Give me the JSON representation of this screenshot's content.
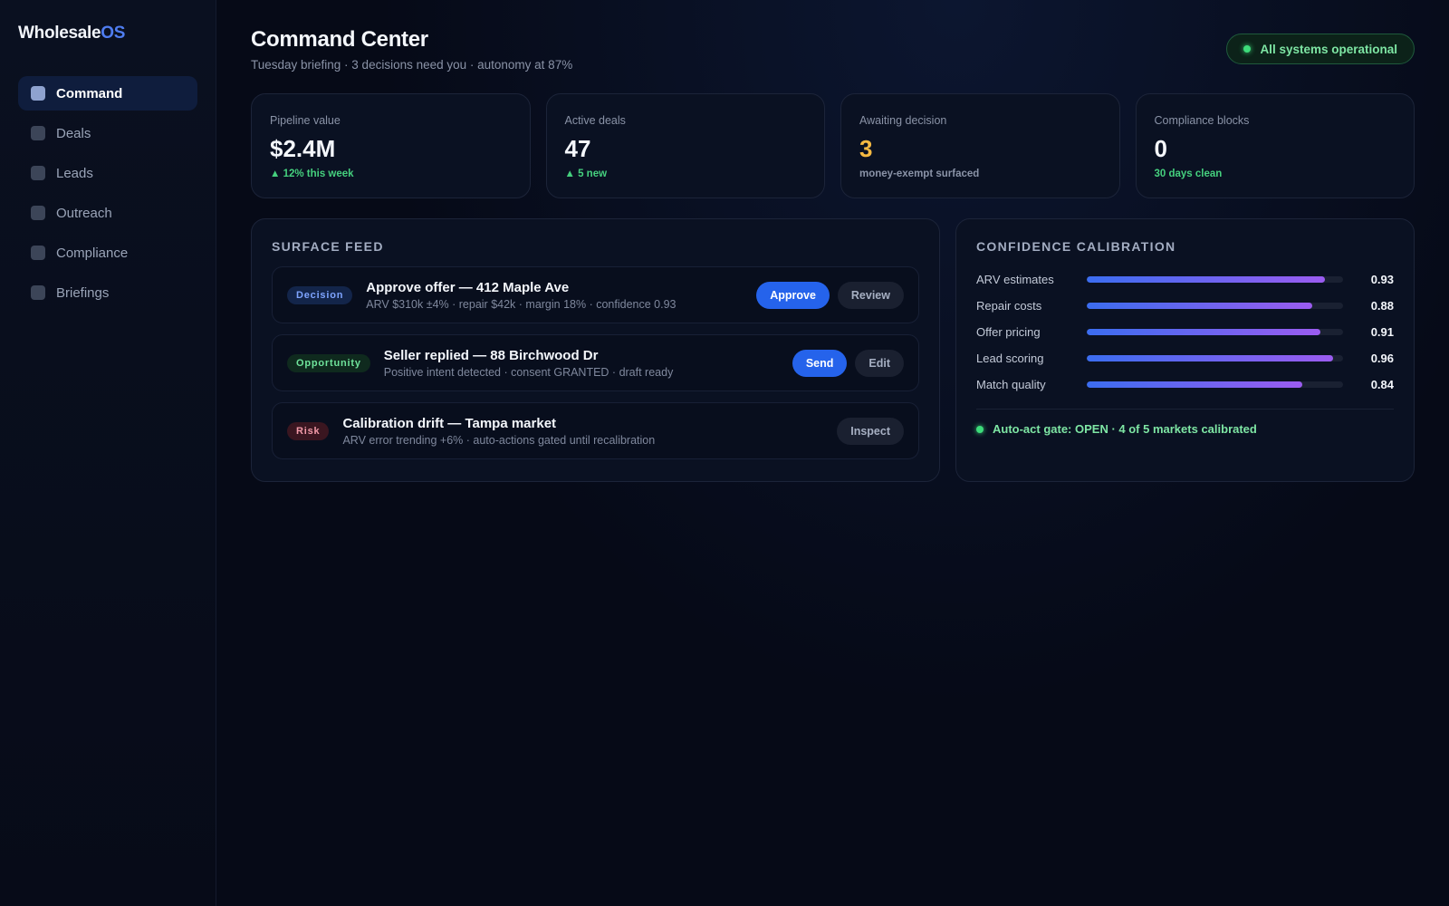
{
  "brand": {
    "name": "Wholesale",
    "accent": "OS"
  },
  "sidebar": {
    "items": [
      {
        "label": "Command",
        "icon": "command-icon",
        "active": true
      },
      {
        "label": "Deals",
        "icon": "deals-icon"
      },
      {
        "label": "Leads",
        "icon": "leads-icon"
      },
      {
        "label": "Outreach",
        "icon": "outreach-icon"
      },
      {
        "label": "Compliance",
        "icon": "compliance-icon"
      },
      {
        "label": "Briefings",
        "icon": "briefings-icon"
      }
    ]
  },
  "header": {
    "title": "Command Center",
    "subtitle": "Tuesday briefing · 3 decisions need you · autonomy at 87%",
    "status": "All systems operational"
  },
  "kpis": [
    {
      "label": "Pipeline value",
      "value": "$2.4M",
      "sub": "▲ 12% this week"
    },
    {
      "label": "Active deals",
      "value": "47",
      "sub": "▲ 5 new"
    },
    {
      "label": "Awaiting decision",
      "value": "3",
      "sub": "money-exempt surfaced"
    },
    {
      "label": "Compliance blocks",
      "value": "0",
      "sub": "30 days clean"
    }
  ],
  "feed": {
    "title": "SURFACE FEED",
    "items": [
      {
        "tag": "Decision",
        "title": "Approve offer — 412 Maple Ave",
        "meta": "ARV $310k ±4% · repair $42k · margin 18% · confidence 0.93",
        "actions": [
          "Approve",
          "Review"
        ]
      },
      {
        "tag": "Opportunity",
        "title": "Seller replied — 88 Birchwood Dr",
        "meta": "Positive intent detected · consent GRANTED · draft ready",
        "actions": [
          "Send",
          "Edit"
        ]
      },
      {
        "tag": "Risk",
        "title": "Calibration drift — Tampa market",
        "meta": "ARV error trending +6% · auto-actions gated until recalibration",
        "actions": [
          "Inspect"
        ]
      }
    ]
  },
  "calibration": {
    "title": "CONFIDENCE CALIBRATION",
    "rows": [
      {
        "label": "ARV estimates",
        "value": 0.93,
        "display": "0.93"
      },
      {
        "label": "Repair costs",
        "value": 0.88,
        "display": "0.88"
      },
      {
        "label": "Offer pricing",
        "value": 0.91,
        "display": "0.91"
      },
      {
        "label": "Lead scoring",
        "value": 0.96,
        "display": "0.96"
      },
      {
        "label": "Match quality",
        "value": 0.84,
        "display": "0.84"
      }
    ],
    "gate": "Auto-act gate: OPEN · 4 of 5 markets calibrated"
  },
  "colors": {
    "accent": "#4f7df0",
    "success": "#3ddc7a",
    "warning": "#f5b942",
    "primary_button": "#2563eb"
  }
}
